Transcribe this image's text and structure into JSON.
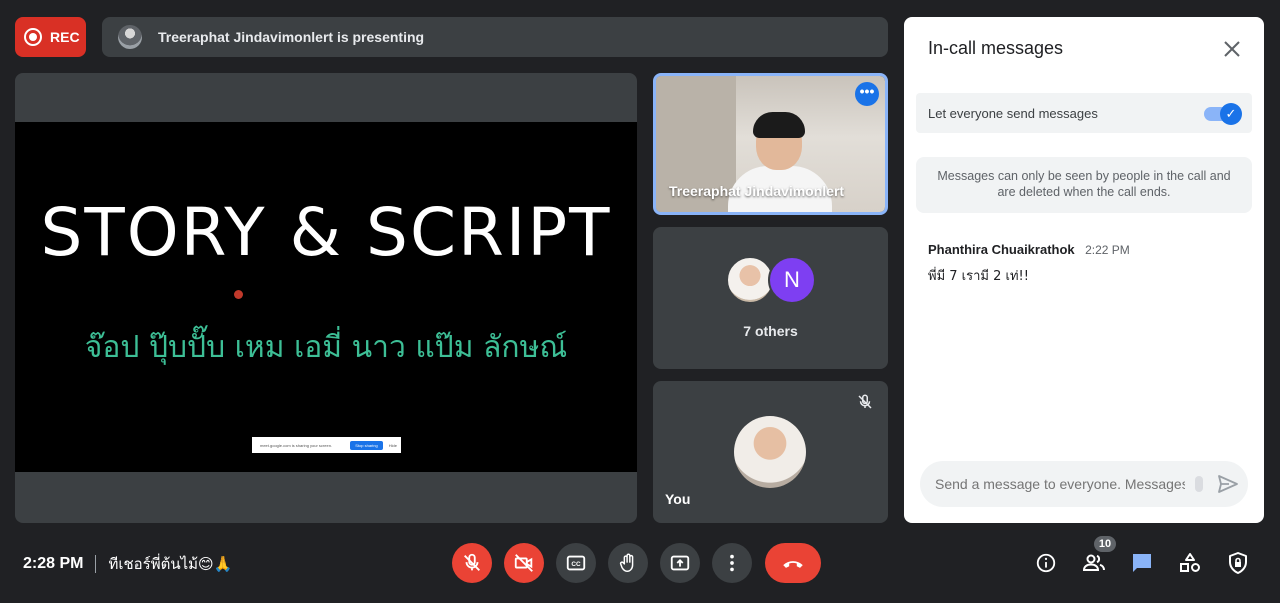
{
  "recording": {
    "label": "REC"
  },
  "presenting": {
    "text": "Treeraphat Jindavimonlert is presenting"
  },
  "slide": {
    "title": "STORY & SCRIPT",
    "subtitle": "จ๊อป ปุ๊บปั๊บ เหม เอมี่ นาว แป๊ม ลักษณ์",
    "share_banner": {
      "text": "meet.google.com is sharing your screen.",
      "stop_label": "Stop sharing",
      "hide_label": "Hide"
    }
  },
  "tiles": {
    "presenter": {
      "name": "Treeraphat Jindavimonlert",
      "more_icon": "•••"
    },
    "others": {
      "avatar_letter": "N",
      "label": "7 others"
    },
    "self": {
      "name": "You"
    }
  },
  "panel": {
    "title": "In-call messages",
    "toggle_label": "Let everyone send messages",
    "toggle_on": true,
    "notice": "Messages can only be seen by people in the call and are deleted when the call ends.",
    "messages": [
      {
        "sender": "Phanthira Chuaikrathok",
        "time": "2:22 PM",
        "body": "พี่มี 7 เรามี 2 เท่!!"
      }
    ],
    "composer_placeholder": "Send a message to everyone. Messages"
  },
  "bottom": {
    "time": "2:28 PM",
    "meeting_name": "ทีเชอร์พี่ต้นไม้😊🙏",
    "participant_count": "10"
  },
  "colors": {
    "accent": "#1a73e8",
    "danger": "#ea4335",
    "background": "#202124",
    "surface": "#3c4043",
    "slide_subtitle": "#3dbf96"
  }
}
